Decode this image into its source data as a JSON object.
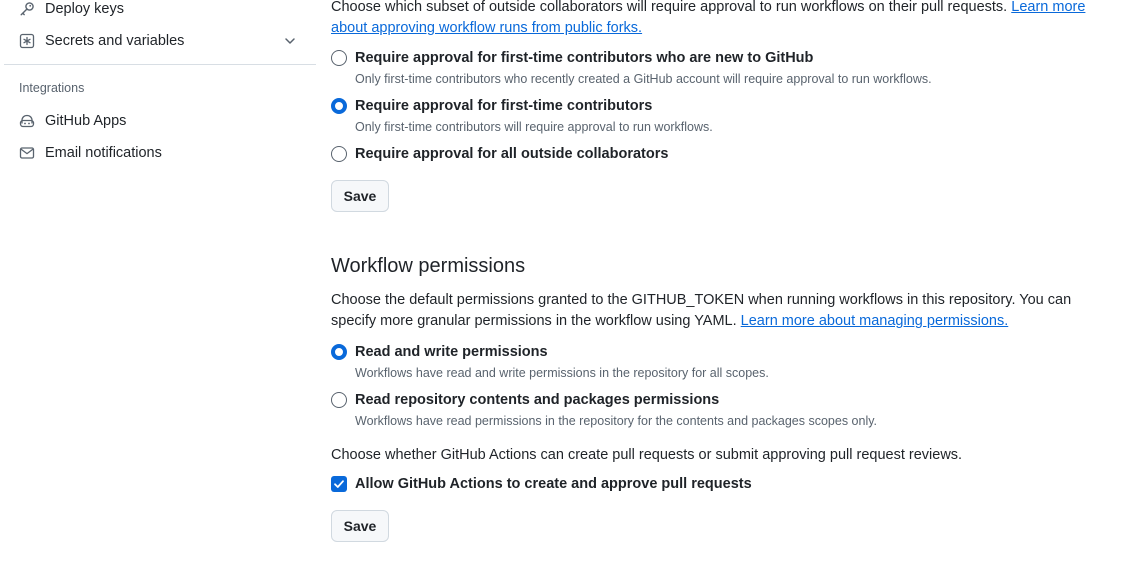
{
  "sidebar": {
    "items": [
      {
        "label": "Deploy keys",
        "icon": "key-icon"
      },
      {
        "label": "Secrets and variables",
        "icon": "asterisk-icon",
        "expandable": true
      }
    ],
    "integrations_heading": "Integrations",
    "integration_items": [
      {
        "label": "GitHub Apps",
        "icon": "github-apps-icon"
      },
      {
        "label": "Email notifications",
        "icon": "mail-icon"
      }
    ]
  },
  "fork_approval": {
    "intro": "Choose which subset of outside collaborators will require approval to run workflows on their pull requests.",
    "link_line1": "Learn more",
    "link_line2": "about approving workflow runs from public forks.",
    "options": [
      {
        "label": "Require approval for first-time contributors who are new to GitHub",
        "description": "Only first-time contributors who recently created a GitHub account will require approval to run workflows.",
        "selected": false
      },
      {
        "label": "Require approval for first-time contributors",
        "description": "Only first-time contributors will require approval to run workflows.",
        "selected": true
      },
      {
        "label": "Require approval for all outside collaborators",
        "description": "",
        "selected": false
      }
    ],
    "save_label": "Save"
  },
  "workflow_permissions": {
    "title": "Workflow permissions",
    "intro_line1": "Choose the default permissions granted to the GITHUB_TOKEN when running workflows in this repository. You can",
    "intro_line2": "specify more granular permissions in the workflow using YAML.",
    "link": "Learn more about managing permissions.",
    "options": [
      {
        "label": "Read and write permissions",
        "description": "Workflows have read and write permissions in the repository for all scopes.",
        "selected": true
      },
      {
        "label": "Read repository contents and packages permissions",
        "description": "Workflows have read permissions in the repository for the contents and packages scopes only.",
        "selected": false
      }
    ],
    "pr_prompt": "Choose whether GitHub Actions can create pull requests or submit approving pull request reviews.",
    "pr_checkbox_label": "Allow GitHub Actions to create and approve pull requests",
    "pr_checkbox_checked": true,
    "save_label": "Save"
  },
  "colors": {
    "accent": "#0969da",
    "text": "#1f2328",
    "muted": "#59636e",
    "border": "#d1d9e0",
    "button_bg": "#f6f8fa"
  }
}
